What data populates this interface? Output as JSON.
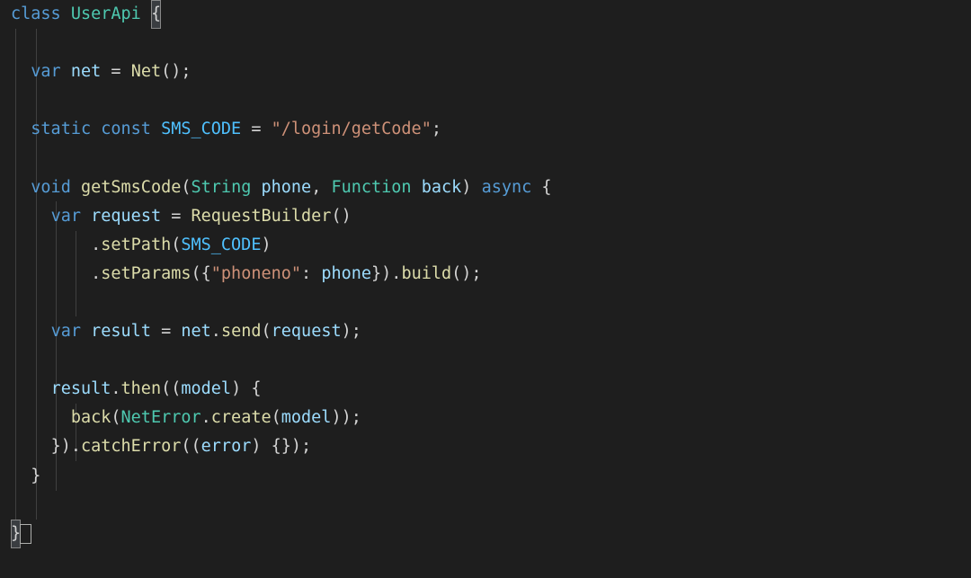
{
  "code": {
    "tokens": {
      "class": "class",
      "UserApi": "UserApi",
      "var": "var",
      "net": "net",
      "eq": "=",
      "Net": "Net",
      "static": "static",
      "const": "const",
      "SMS_CODE": "SMS_CODE",
      "sms_code_value": "\"/login/getCode\"",
      "void": "void",
      "getSmsCode": "getSmsCode",
      "String": "String",
      "phone": "phone",
      "Function": "Function",
      "back": "back",
      "async": "async",
      "request": "request",
      "RequestBuilder": "RequestBuilder",
      "setPath": "setPath",
      "setParams": "setParams",
      "phoneno_key": "\"phoneno\"",
      "build": "build",
      "result": "result",
      "send": "send",
      "then": "then",
      "model": "model",
      "NetError": "NetError",
      "create": "create",
      "catchError": "catchError",
      "error": "error"
    }
  },
  "colors": {
    "background": "#1e1e1e",
    "keyword": "#569cd6",
    "controlKeyword": "#c586c0",
    "type": "#4ec9b0",
    "function": "#dcdcaa",
    "variable": "#9cdcfe",
    "constant": "#4fc1ff",
    "string": "#ce9178",
    "default": "#d4d4d4",
    "indentGuide": "#404040"
  },
  "editor": {
    "language": "dart",
    "fontSize": 18.5,
    "lineHeight": 32.1
  }
}
